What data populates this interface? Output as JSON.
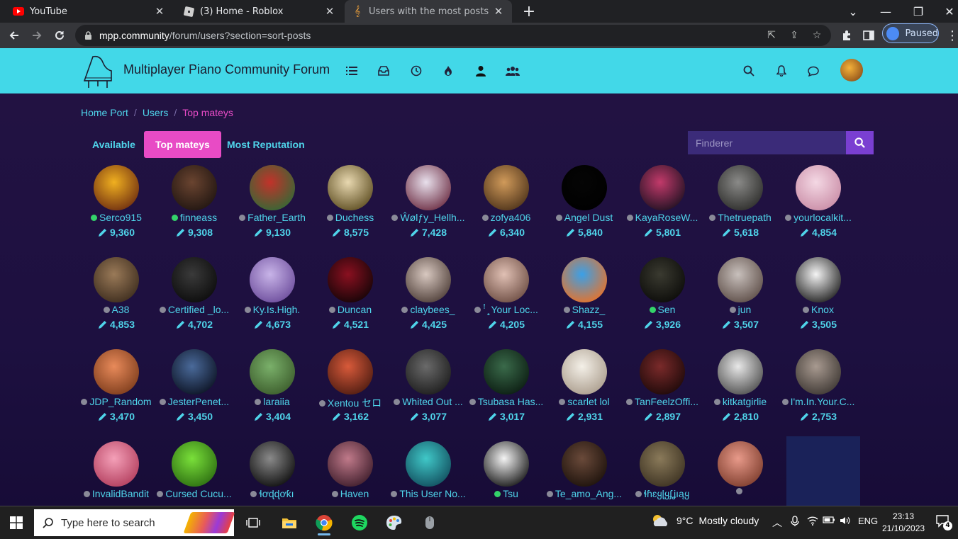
{
  "browser": {
    "tabs": [
      {
        "title": "YouTube",
        "icon": "youtube-icon"
      },
      {
        "title": "(3) Home - Roblox",
        "icon": "roblox-icon"
      },
      {
        "title": "Users with the most posts | mpp",
        "icon": "mpp-icon"
      }
    ],
    "url_host": "mpp.community",
    "url_path": "/forum/users?section=sort-posts",
    "profile_label": "Paused"
  },
  "forum": {
    "brand": "Multiplayer Piano Community Forum",
    "breadcrumb": [
      "Home Port",
      "Users",
      "Top mateys"
    ],
    "subtabs": [
      "Available",
      "Top mateys",
      "Most Reputation"
    ],
    "search_placeholder": "Finderer",
    "users": [
      {
        "name": "Serco915",
        "posts": "9,360",
        "online": true,
        "colors": [
          "#f0b020",
          "#6b2a10"
        ]
      },
      {
        "name": "finneass",
        "posts": "9,308",
        "online": true,
        "colors": [
          "#6a4430",
          "#1e1410"
        ]
      },
      {
        "name": "Father_Earth",
        "posts": "9,130",
        "online": false,
        "colors": [
          "#c2322a",
          "#2e6b36"
        ]
      },
      {
        "name": "Duchess",
        "posts": "8,575",
        "online": false,
        "colors": [
          "#e8d8b0",
          "#5a4a1e"
        ]
      },
      {
        "name": "Ŵølƒy_Hellh...",
        "posts": "7,428",
        "online": false,
        "colors": [
          "#e8e0ec",
          "#6a2a40"
        ]
      },
      {
        "name": "zofya406",
        "posts": "6,340",
        "online": false,
        "colors": [
          "#d09a5a",
          "#4a3018"
        ]
      },
      {
        "name": "Angel Dust",
        "posts": "5,840",
        "online": false,
        "colors": [
          "#050505",
          "#000000"
        ]
      },
      {
        "name": "KayaRoseW...",
        "posts": "5,801",
        "online": false,
        "colors": [
          "#c23a6a",
          "#1a1020"
        ]
      },
      {
        "name": "Thetruepath",
        "posts": "5,618",
        "online": false,
        "colors": [
          "#8a8a88",
          "#2a2a28"
        ]
      },
      {
        "name": "yourlocalkit...",
        "posts": "4,854",
        "online": false,
        "colors": [
          "#f4d8e4",
          "#c88aa4"
        ]
      },
      {
        "name": "A38",
        "posts": "4,853",
        "online": false,
        "colors": [
          "#9a7a58",
          "#3a2a1c"
        ]
      },
      {
        "name": "Certified _lo...",
        "posts": "4,702",
        "online": false,
        "colors": [
          "#3a3a3a",
          "#0a0a0a"
        ]
      },
      {
        "name": "Ky.Is.High.",
        "posts": "4,673",
        "online": false,
        "colors": [
          "#c8b4e8",
          "#6a4a9a"
        ]
      },
      {
        "name": "Duncan",
        "posts": "4,521",
        "online": false,
        "colors": [
          "#8a1020",
          "#100406"
        ]
      },
      {
        "name": "claybees_",
        "posts": "4,425",
        "online": false,
        "colors": [
          "#d8c8c0",
          "#4a3a34"
        ]
      },
      {
        "name": "ꜝ ̥̥̥ Your Loc...",
        "posts": "4,205",
        "online": false,
        "colors": [
          "#e0c0b4",
          "#6a4a40"
        ]
      },
      {
        "name": "Shazz_",
        "posts": "4,155",
        "online": false,
        "colors": [
          "#3aa0e8",
          "#f07020"
        ]
      },
      {
        "name": "Sen",
        "posts": "3,926",
        "online": true,
        "colors": [
          "#3a3a30",
          "#0a0a08"
        ]
      },
      {
        "name": "jun",
        "posts": "3,507",
        "online": false,
        "colors": [
          "#c8c0bc",
          "#5a4a44"
        ]
      },
      {
        "name": "Knox",
        "posts": "3,505",
        "online": false,
        "colors": [
          "#f4f4f4",
          "#1a1a1a"
        ]
      },
      {
        "name": "JDP_Random",
        "posts": "3,470",
        "online": false,
        "colors": [
          "#e88a5a",
          "#7a3a1a"
        ]
      },
      {
        "name": "JesterPenet...",
        "posts": "3,450",
        "online": false,
        "colors": [
          "#4a6a9a",
          "#0a1020"
        ]
      },
      {
        "name": "laraiia",
        "posts": "3,404",
        "online": false,
        "colors": [
          "#7ab06a",
          "#3a5a2a"
        ]
      },
      {
        "name": "Xentou セロ",
        "posts": "3,162",
        "online": false,
        "colors": [
          "#d85a3a",
          "#4a1a10"
        ]
      },
      {
        "name": "Whited Out ...",
        "posts": "3,077",
        "online": false,
        "colors": [
          "#6a6a6a",
          "#1a1a1a"
        ]
      },
      {
        "name": "Tsubasa Has...",
        "posts": "3,017",
        "online": false,
        "colors": [
          "#3a6a4a",
          "#0a1a10"
        ]
      },
      {
        "name": "scarlet lol",
        "posts": "2,931",
        "online": false,
        "colors": [
          "#f4f0e8",
          "#a89a8a"
        ]
      },
      {
        "name": "TanFeelzOffi...",
        "posts": "2,897",
        "online": false,
        "colors": [
          "#7a2a2a",
          "#1a0808"
        ]
      },
      {
        "name": "kitkatgirlie",
        "posts": "2,810",
        "online": false,
        "colors": [
          "#e8e8e8",
          "#4a4a4a"
        ]
      },
      {
        "name": "I'm.In.Your.C...",
        "posts": "2,753",
        "online": false,
        "colors": [
          "#a89a90",
          "#3a3430"
        ]
      },
      {
        "name": "InvalidBandit",
        "posts": "",
        "online": false,
        "colors": [
          "#f4a0b8",
          "#b03a5a"
        ]
      },
      {
        "name": "Cursed Cucu...",
        "posts": "",
        "online": false,
        "colors": [
          "#7ae03a",
          "#2a6a10"
        ]
      },
      {
        "name": "ɬơɖɖơƙı",
        "posts": "",
        "online": false,
        "colors": [
          "#8a8a8a",
          "#0a0a0a"
        ]
      },
      {
        "name": "Haven",
        "posts": "",
        "online": false,
        "colors": [
          "#c07a8a",
          "#3a1a28"
        ]
      },
      {
        "name": "This User No...",
        "posts": "",
        "online": false,
        "colors": [
          "#40c8c8",
          "#104a5a"
        ]
      },
      {
        "name": "Tsu",
        "posts": "",
        "online": true,
        "colors": [
          "#f4f4f4",
          "#101010"
        ]
      },
      {
        "name": "Te_amo_Ang...",
        "posts": "",
        "online": false,
        "colors": [
          "#6a4a3a",
          "#1a100a"
        ]
      },
      {
        "name": "ɬɦɛყɭყʄʝıąყ",
        "posts": "",
        "online": false,
        "colors": [
          "#8a7a5a",
          "#3a3020"
        ]
      },
      {
        "name": "",
        "posts": "",
        "online": false,
        "colors": [
          "#e89a8a",
          "#7a3a2a"
        ]
      }
    ]
  },
  "taskbar": {
    "search_placeholder": "Type here to search",
    "weather_temp": "9°C",
    "weather_desc": "Mostly cloudy",
    "lang": "ENG",
    "time": "23:13",
    "date": "21/10/2023",
    "notif_count": "4"
  }
}
